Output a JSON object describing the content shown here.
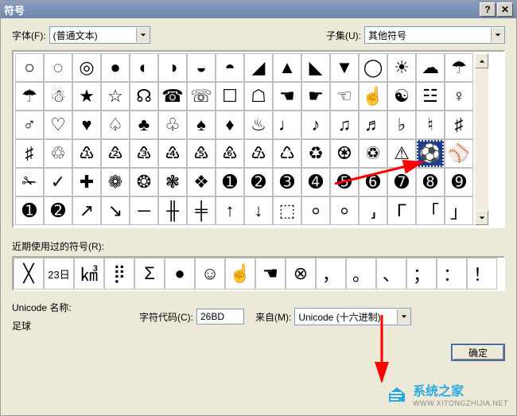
{
  "title": "符号",
  "font_label": "字体(F):",
  "font_value": "(普通文本)",
  "subset_label": "子集(U):",
  "subset_value": "其他符号",
  "symbol_rows": [
    [
      "○",
      "◌",
      "◎",
      "●",
      "◐",
      "◑",
      "◒",
      "◓",
      "◢",
      "▲",
      "◣",
      "▼",
      "◯",
      "☀",
      "☁",
      "☂"
    ],
    [
      "☂",
      "☃",
      "★",
      "☆",
      "☊",
      "☎",
      "☏",
      "☐",
      "☖",
      "☚",
      "☛",
      "☜",
      "☝",
      "☯",
      "☳",
      "♀"
    ],
    [
      "♂",
      "♡",
      "♥",
      "♤",
      "♣",
      "♧",
      "♠",
      "♦",
      "♨",
      "♩",
      "♪",
      "♫",
      "♬",
      "♭",
      "♮",
      "♯"
    ],
    [
      "♯",
      "♲",
      "♳",
      "♴",
      "♵",
      "♶",
      "♷",
      "♸",
      "♹",
      "♺",
      "♻",
      "♼",
      "♽",
      "⚠",
      "⚽",
      "⚾"
    ],
    [
      "✁",
      "✓",
      "✚",
      "❁",
      "❂",
      "❃",
      "❖",
      "➊",
      "➋",
      "➌",
      "➍",
      "➎",
      "➏",
      "➐",
      "➑",
      "➒"
    ],
    [
      "➊",
      "➋",
      "↗",
      "↘",
      "─",
      "╫",
      "╪",
      "↑",
      "↓",
      "⬚",
      "⸰",
      "⸰",
      "⸥",
      "Γ",
      "「",
      "」"
    ]
  ],
  "selected": {
    "row": 3,
    "col": 14
  },
  "recent_label": "近期使用过的符号(R):",
  "recent": [
    "╳",
    "23日",
    "㎦",
    "⡿",
    "Σ",
    "●",
    "☺",
    "☝",
    "☚",
    "⊗",
    "，",
    "。",
    "、",
    "；",
    "：",
    "！"
  ],
  "unicode_name_label": "Unicode 名称:",
  "unicode_name_value": "足球",
  "char_code_label": "字符代码(C):",
  "char_code_value": "26BD",
  "from_label": "来自(M):",
  "from_value": "Unicode (十六进制)",
  "ok_label": "确定",
  "watermark": {
    "line1": "系统之家",
    "line2": "WWW.XITONGZHIJIA.NET"
  }
}
